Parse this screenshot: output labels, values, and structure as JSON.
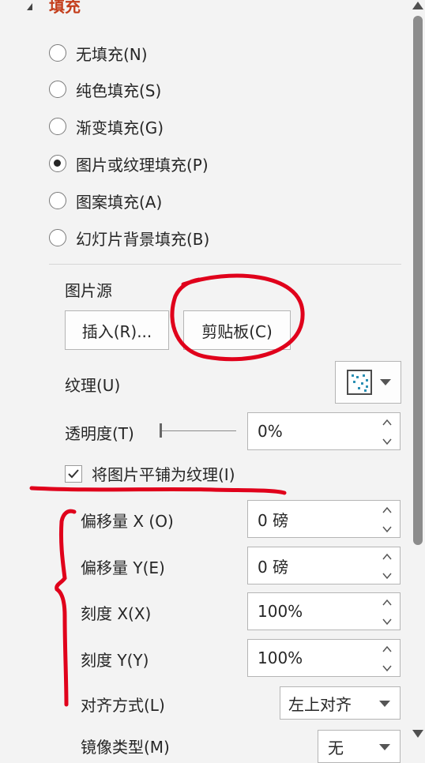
{
  "section": {
    "title": "填充"
  },
  "fill_options": [
    {
      "label": "无填充(N)",
      "checked": false
    },
    {
      "label": "纯色填充(S)",
      "checked": false
    },
    {
      "label": "渐变填充(G)",
      "checked": false
    },
    {
      "label": "图片或纹理填充(P)",
      "checked": true
    },
    {
      "label": "图案填充(A)",
      "checked": false
    },
    {
      "label": "幻灯片背景填充(B)",
      "checked": false
    }
  ],
  "picture_source": {
    "label": "图片源",
    "insert_button": "插入(R)...",
    "clipboard_button": "剪贴板(C)"
  },
  "texture": {
    "label": "纹理(U)"
  },
  "transparency": {
    "label": "透明度(T)",
    "value": "0%",
    "slider_level": 0
  },
  "tile_checkbox": {
    "label": "将图片平铺为纹理(I)",
    "checked": true
  },
  "offset_x": {
    "label": "偏移量 X (O)",
    "value": "0 磅"
  },
  "offset_y": {
    "label": "偏移量 Y(E)",
    "value": "0 磅"
  },
  "scale_x": {
    "label": "刻度 X(X)",
    "value": "100%"
  },
  "scale_y": {
    "label": "刻度 Y(Y)",
    "value": "100%"
  },
  "alignment": {
    "label": "对齐方式(L)",
    "value": "左上对齐"
  },
  "mirror_type": {
    "label": "镜像类型(M)",
    "value": "无"
  },
  "colors": {
    "accent_title": "#c43e1c",
    "annotation": "#e0001b"
  }
}
